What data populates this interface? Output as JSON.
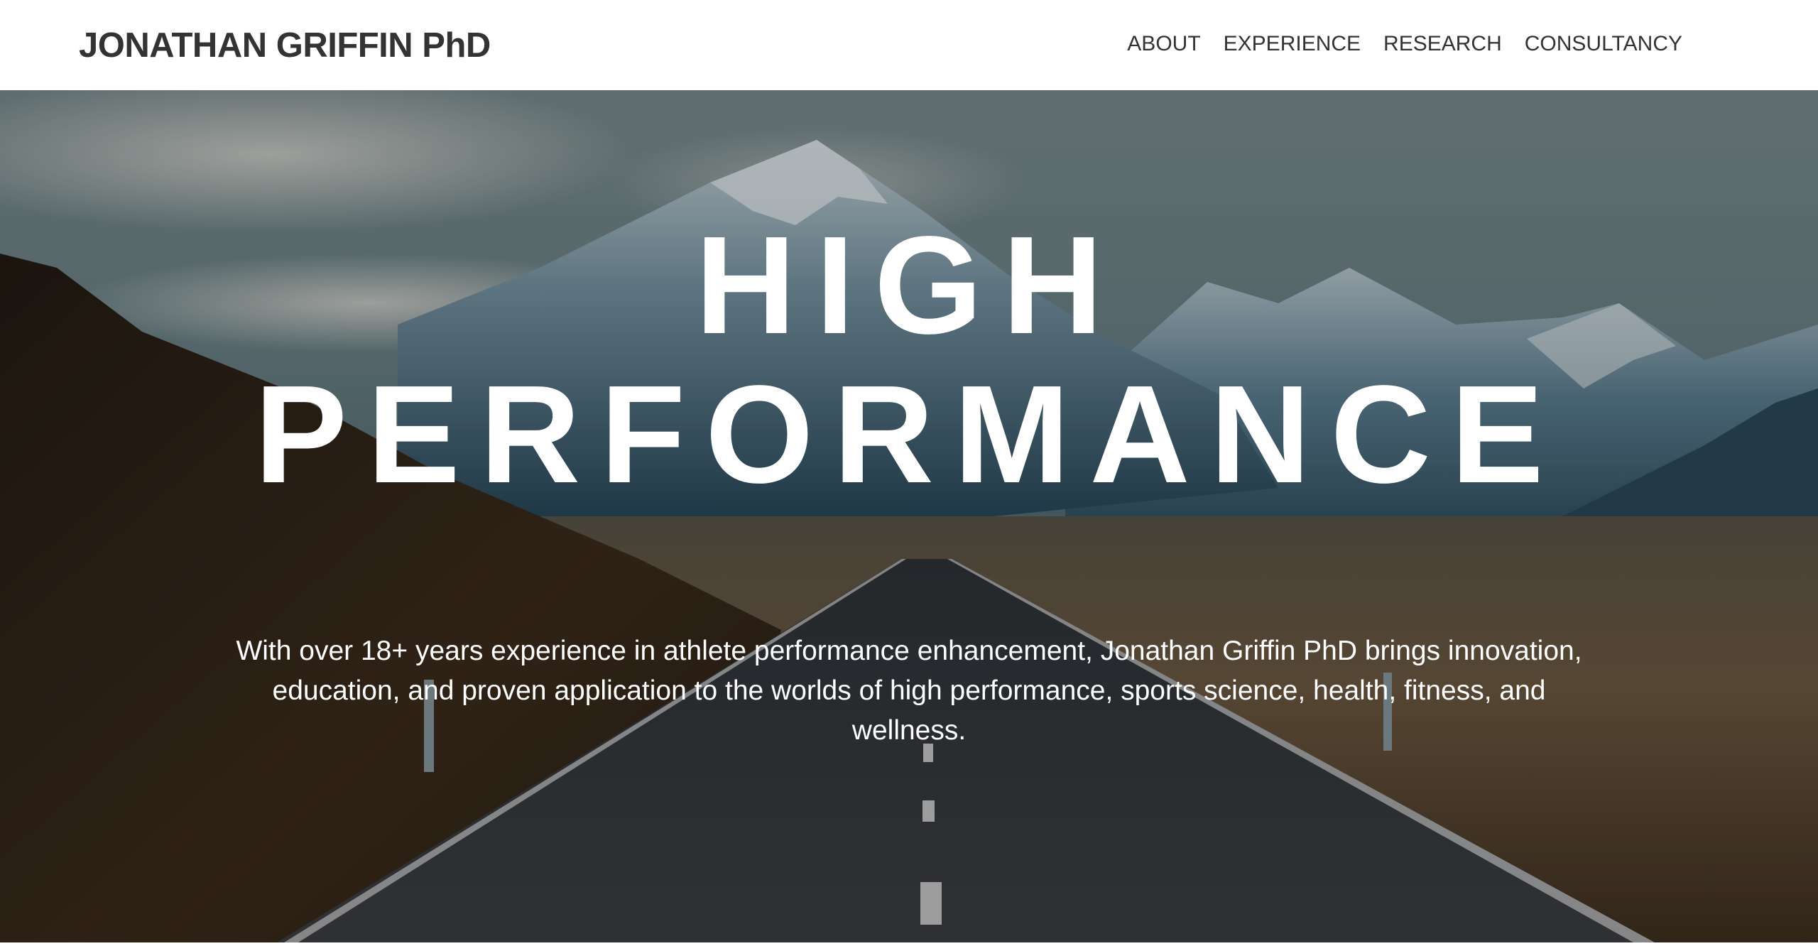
{
  "header": {
    "brand": "JONATHAN GRIFFIN PhD",
    "nav": [
      "ABOUT",
      "EXPERIENCE",
      "RESEARCH",
      "CONSULTANCY"
    ]
  },
  "hero": {
    "headline_line1": "HIGH",
    "headline_line2": "PERFORMANCE",
    "intro": "With over 18+ years experience in athlete performance enhancement, Jonathan Griffin PhD brings innovation, education, and proven application to the worlds of high performance, sports science, health, fitness, and wellness.",
    "background": "mountain-road-photo"
  },
  "colors": {
    "header_bg": "#ffffff",
    "brand_text": "#333333",
    "nav_text": "#333333",
    "hero_text": "#ffffff"
  }
}
